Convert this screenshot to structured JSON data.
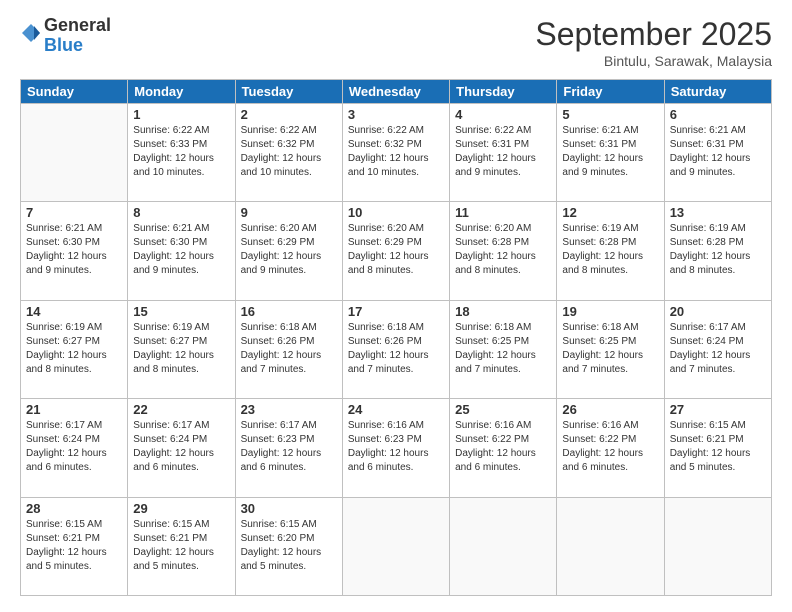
{
  "header": {
    "logo_general": "General",
    "logo_blue": "Blue",
    "month_title": "September 2025",
    "location": "Bintulu, Sarawak, Malaysia"
  },
  "weekdays": [
    "Sunday",
    "Monday",
    "Tuesday",
    "Wednesday",
    "Thursday",
    "Friday",
    "Saturday"
  ],
  "weeks": [
    [
      {
        "day": "",
        "info": ""
      },
      {
        "day": "1",
        "info": "Sunrise: 6:22 AM\nSunset: 6:33 PM\nDaylight: 12 hours\nand 10 minutes."
      },
      {
        "day": "2",
        "info": "Sunrise: 6:22 AM\nSunset: 6:32 PM\nDaylight: 12 hours\nand 10 minutes."
      },
      {
        "day": "3",
        "info": "Sunrise: 6:22 AM\nSunset: 6:32 PM\nDaylight: 12 hours\nand 10 minutes."
      },
      {
        "day": "4",
        "info": "Sunrise: 6:22 AM\nSunset: 6:31 PM\nDaylight: 12 hours\nand 9 minutes."
      },
      {
        "day": "5",
        "info": "Sunrise: 6:21 AM\nSunset: 6:31 PM\nDaylight: 12 hours\nand 9 minutes."
      },
      {
        "day": "6",
        "info": "Sunrise: 6:21 AM\nSunset: 6:31 PM\nDaylight: 12 hours\nand 9 minutes."
      }
    ],
    [
      {
        "day": "7",
        "info": "Sunrise: 6:21 AM\nSunset: 6:30 PM\nDaylight: 12 hours\nand 9 minutes."
      },
      {
        "day": "8",
        "info": "Sunrise: 6:21 AM\nSunset: 6:30 PM\nDaylight: 12 hours\nand 9 minutes."
      },
      {
        "day": "9",
        "info": "Sunrise: 6:20 AM\nSunset: 6:29 PM\nDaylight: 12 hours\nand 9 minutes."
      },
      {
        "day": "10",
        "info": "Sunrise: 6:20 AM\nSunset: 6:29 PM\nDaylight: 12 hours\nand 8 minutes."
      },
      {
        "day": "11",
        "info": "Sunrise: 6:20 AM\nSunset: 6:28 PM\nDaylight: 12 hours\nand 8 minutes."
      },
      {
        "day": "12",
        "info": "Sunrise: 6:19 AM\nSunset: 6:28 PM\nDaylight: 12 hours\nand 8 minutes."
      },
      {
        "day": "13",
        "info": "Sunrise: 6:19 AM\nSunset: 6:28 PM\nDaylight: 12 hours\nand 8 minutes."
      }
    ],
    [
      {
        "day": "14",
        "info": "Sunrise: 6:19 AM\nSunset: 6:27 PM\nDaylight: 12 hours\nand 8 minutes."
      },
      {
        "day": "15",
        "info": "Sunrise: 6:19 AM\nSunset: 6:27 PM\nDaylight: 12 hours\nand 8 minutes."
      },
      {
        "day": "16",
        "info": "Sunrise: 6:18 AM\nSunset: 6:26 PM\nDaylight: 12 hours\nand 7 minutes."
      },
      {
        "day": "17",
        "info": "Sunrise: 6:18 AM\nSunset: 6:26 PM\nDaylight: 12 hours\nand 7 minutes."
      },
      {
        "day": "18",
        "info": "Sunrise: 6:18 AM\nSunset: 6:25 PM\nDaylight: 12 hours\nand 7 minutes."
      },
      {
        "day": "19",
        "info": "Sunrise: 6:18 AM\nSunset: 6:25 PM\nDaylight: 12 hours\nand 7 minutes."
      },
      {
        "day": "20",
        "info": "Sunrise: 6:17 AM\nSunset: 6:24 PM\nDaylight: 12 hours\nand 7 minutes."
      }
    ],
    [
      {
        "day": "21",
        "info": "Sunrise: 6:17 AM\nSunset: 6:24 PM\nDaylight: 12 hours\nand 6 minutes."
      },
      {
        "day": "22",
        "info": "Sunrise: 6:17 AM\nSunset: 6:24 PM\nDaylight: 12 hours\nand 6 minutes."
      },
      {
        "day": "23",
        "info": "Sunrise: 6:17 AM\nSunset: 6:23 PM\nDaylight: 12 hours\nand 6 minutes."
      },
      {
        "day": "24",
        "info": "Sunrise: 6:16 AM\nSunset: 6:23 PM\nDaylight: 12 hours\nand 6 minutes."
      },
      {
        "day": "25",
        "info": "Sunrise: 6:16 AM\nSunset: 6:22 PM\nDaylight: 12 hours\nand 6 minutes."
      },
      {
        "day": "26",
        "info": "Sunrise: 6:16 AM\nSunset: 6:22 PM\nDaylight: 12 hours\nand 6 minutes."
      },
      {
        "day": "27",
        "info": "Sunrise: 6:15 AM\nSunset: 6:21 PM\nDaylight: 12 hours\nand 5 minutes."
      }
    ],
    [
      {
        "day": "28",
        "info": "Sunrise: 6:15 AM\nSunset: 6:21 PM\nDaylight: 12 hours\nand 5 minutes."
      },
      {
        "day": "29",
        "info": "Sunrise: 6:15 AM\nSunset: 6:21 PM\nDaylight: 12 hours\nand 5 minutes."
      },
      {
        "day": "30",
        "info": "Sunrise: 6:15 AM\nSunset: 6:20 PM\nDaylight: 12 hours\nand 5 minutes."
      },
      {
        "day": "",
        "info": ""
      },
      {
        "day": "",
        "info": ""
      },
      {
        "day": "",
        "info": ""
      },
      {
        "day": "",
        "info": ""
      }
    ]
  ]
}
